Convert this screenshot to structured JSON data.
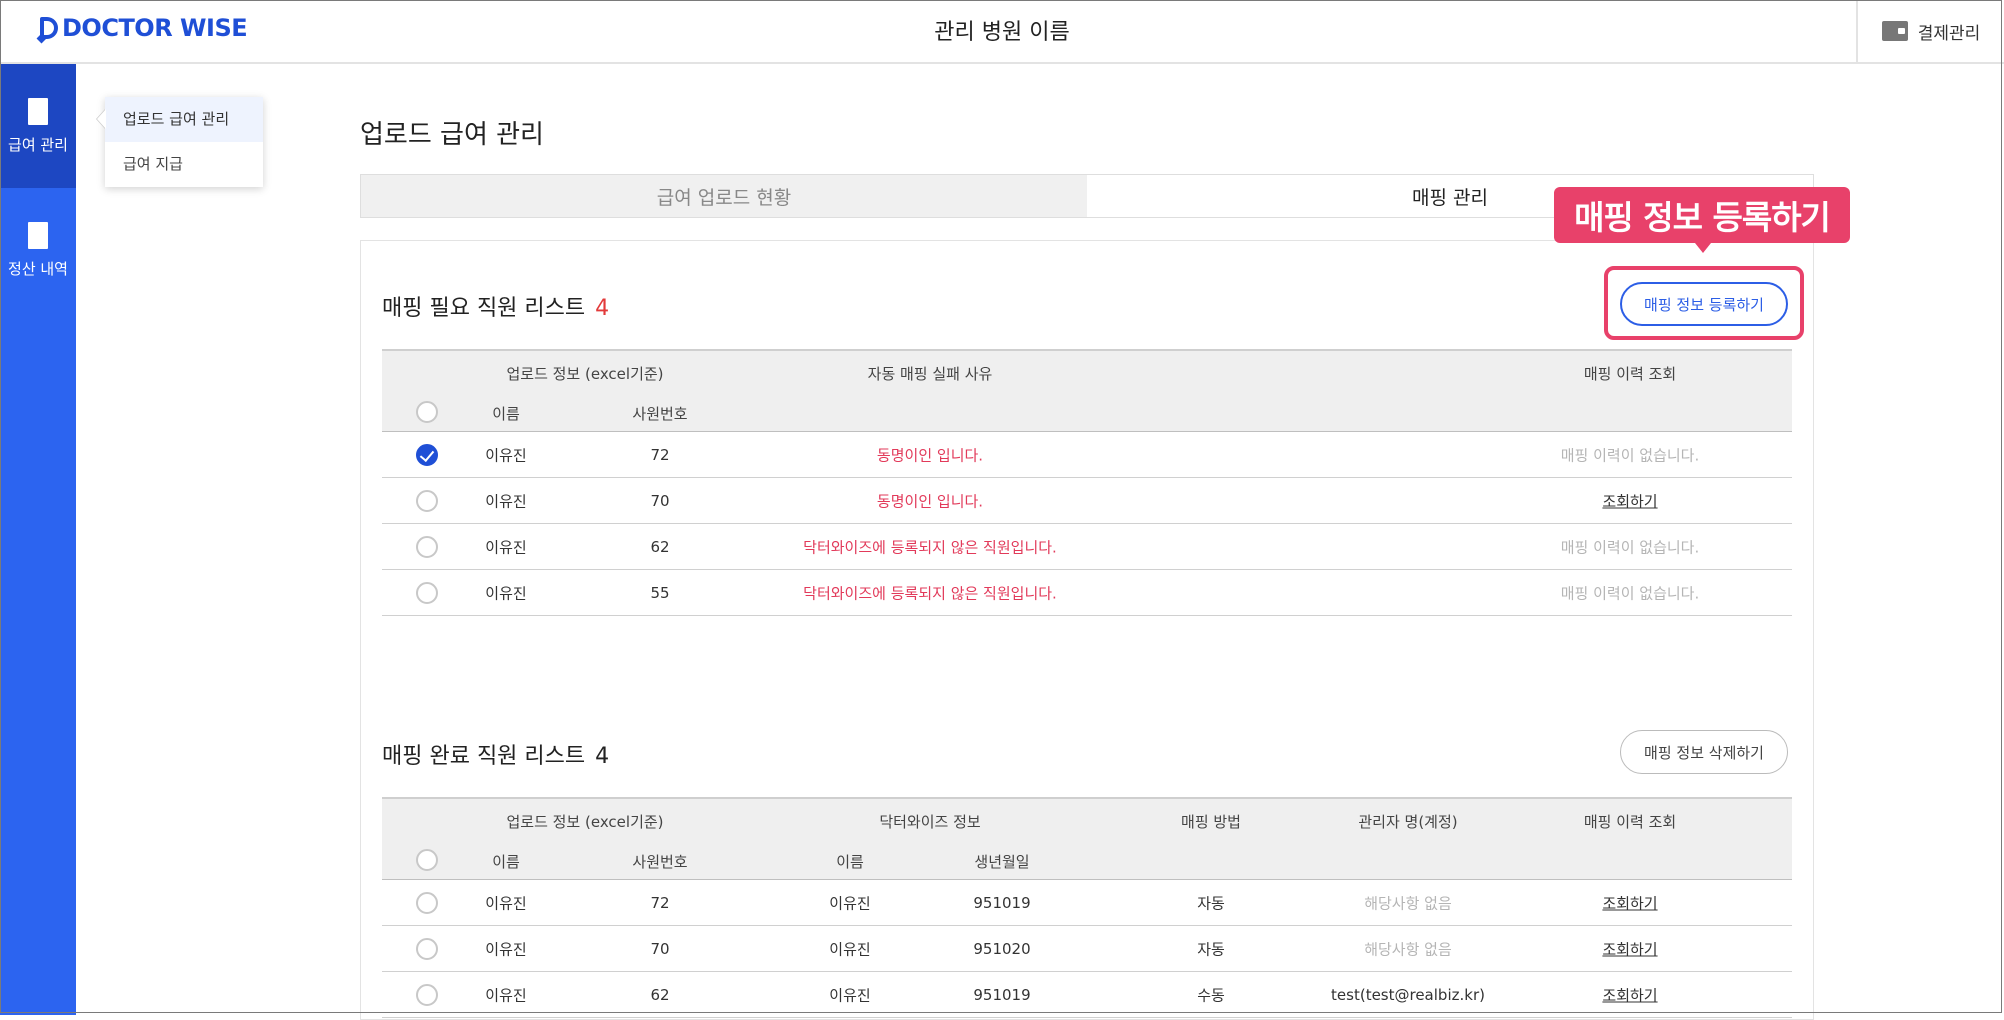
{
  "header": {
    "logo": "DOCTOR WISE",
    "hospital_name": "관리 병원 이름",
    "billing_label": "결제관리"
  },
  "sidebar": {
    "items": [
      {
        "label": "급여 관리",
        "active": true
      },
      {
        "label": "정산 내역",
        "active": false
      }
    ]
  },
  "submenu": {
    "items": [
      {
        "label": "업로드 급여 관리",
        "active": true
      },
      {
        "label": "급여 지급",
        "active": false
      }
    ]
  },
  "page_title": "업로드 급여 관리",
  "tabs": [
    {
      "label": "급여 업로드 현황",
      "active": false
    },
    {
      "label": "매핑 관리",
      "active": true
    }
  ],
  "callout": "매핑 정보 등록하기",
  "pending": {
    "title": "매핑 필요 직원 리스트",
    "count": "4",
    "register_button": "매핑 정보 등록하기",
    "headers": {
      "upload_info": "업로드 정보 (excel기준)",
      "reason": "자동 매핑 실패 사유",
      "history": "매핑 이력 조회",
      "name": "이름",
      "emp_no": "사원번호"
    },
    "rows": [
      {
        "checked": true,
        "name": "이유진",
        "emp_no": "72",
        "reason": "동명이인 입니다.",
        "history": "매핑 이력이 없습니다.",
        "history_is_link": false
      },
      {
        "checked": false,
        "name": "이유진",
        "emp_no": "70",
        "reason": "동명이인 입니다.",
        "history": "조회하기",
        "history_is_link": true
      },
      {
        "checked": false,
        "name": "이유진",
        "emp_no": "62",
        "reason": "닥터와이즈에 등록되지 않은 직원입니다.",
        "history": "매핑 이력이 없습니다.",
        "history_is_link": false
      },
      {
        "checked": false,
        "name": "이유진",
        "emp_no": "55",
        "reason": "닥터와이즈에 등록되지 않은 직원입니다.",
        "history": "매핑 이력이 없습니다.",
        "history_is_link": false
      }
    ]
  },
  "completed": {
    "title": "매핑 완료 직원 리스트",
    "count": "4",
    "delete_button": "매핑 정보 삭제하기",
    "headers": {
      "upload_info": "업로드 정보 (excel기준)",
      "dw_info": "닥터와이즈 정보",
      "method": "매핑 방법",
      "manager": "관리자 명(계정)",
      "history": "매핑 이력 조회",
      "name": "이름",
      "emp_no": "사원번호",
      "dw_name": "이름",
      "birth": "생년월일"
    },
    "rows": [
      {
        "name": "이유진",
        "emp_no": "72",
        "dw_name": "이유진",
        "birth": "951019",
        "method": "자동",
        "manager": "해당사항 없음",
        "manager_empty": true,
        "history": "조회하기"
      },
      {
        "name": "이유진",
        "emp_no": "70",
        "dw_name": "이유진",
        "birth": "951020",
        "method": "자동",
        "manager": "해당사항 없음",
        "manager_empty": true,
        "history": "조회하기"
      },
      {
        "name": "이유진",
        "emp_no": "62",
        "dw_name": "이유진",
        "birth": "951019",
        "method": "수동",
        "manager": "test(test@realbiz.kr)",
        "manager_empty": false,
        "history": "조회하기"
      }
    ]
  }
}
